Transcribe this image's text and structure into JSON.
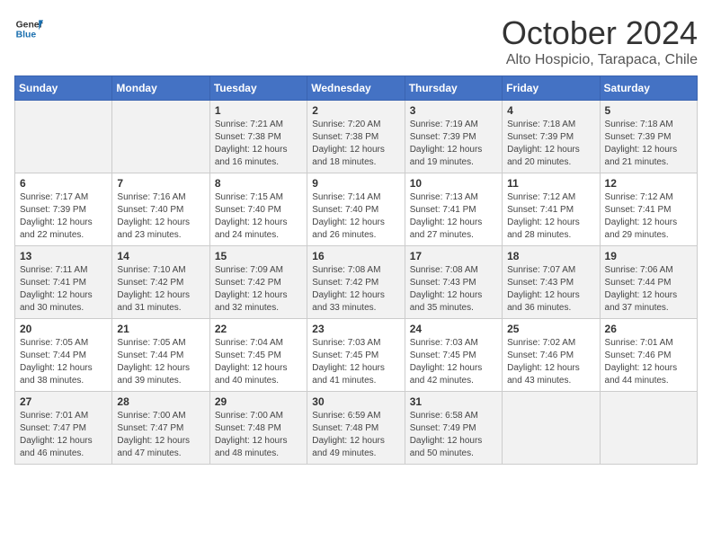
{
  "header": {
    "logo_general": "General",
    "logo_blue": "Blue",
    "month_title": "October 2024",
    "subtitle": "Alto Hospicio, Tarapaca, Chile"
  },
  "days_of_week": [
    "Sunday",
    "Monday",
    "Tuesday",
    "Wednesday",
    "Thursday",
    "Friday",
    "Saturday"
  ],
  "weeks": [
    [
      {
        "day": "",
        "info": ""
      },
      {
        "day": "",
        "info": ""
      },
      {
        "day": "1",
        "info": "Sunrise: 7:21 AM\nSunset: 7:38 PM\nDaylight: 12 hours and 16 minutes."
      },
      {
        "day": "2",
        "info": "Sunrise: 7:20 AM\nSunset: 7:38 PM\nDaylight: 12 hours and 18 minutes."
      },
      {
        "day": "3",
        "info": "Sunrise: 7:19 AM\nSunset: 7:39 PM\nDaylight: 12 hours and 19 minutes."
      },
      {
        "day": "4",
        "info": "Sunrise: 7:18 AM\nSunset: 7:39 PM\nDaylight: 12 hours and 20 minutes."
      },
      {
        "day": "5",
        "info": "Sunrise: 7:18 AM\nSunset: 7:39 PM\nDaylight: 12 hours and 21 minutes."
      }
    ],
    [
      {
        "day": "6",
        "info": "Sunrise: 7:17 AM\nSunset: 7:39 PM\nDaylight: 12 hours and 22 minutes."
      },
      {
        "day": "7",
        "info": "Sunrise: 7:16 AM\nSunset: 7:40 PM\nDaylight: 12 hours and 23 minutes."
      },
      {
        "day": "8",
        "info": "Sunrise: 7:15 AM\nSunset: 7:40 PM\nDaylight: 12 hours and 24 minutes."
      },
      {
        "day": "9",
        "info": "Sunrise: 7:14 AM\nSunset: 7:40 PM\nDaylight: 12 hours and 26 minutes."
      },
      {
        "day": "10",
        "info": "Sunrise: 7:13 AM\nSunset: 7:41 PM\nDaylight: 12 hours and 27 minutes."
      },
      {
        "day": "11",
        "info": "Sunrise: 7:12 AM\nSunset: 7:41 PM\nDaylight: 12 hours and 28 minutes."
      },
      {
        "day": "12",
        "info": "Sunrise: 7:12 AM\nSunset: 7:41 PM\nDaylight: 12 hours and 29 minutes."
      }
    ],
    [
      {
        "day": "13",
        "info": "Sunrise: 7:11 AM\nSunset: 7:41 PM\nDaylight: 12 hours and 30 minutes."
      },
      {
        "day": "14",
        "info": "Sunrise: 7:10 AM\nSunset: 7:42 PM\nDaylight: 12 hours and 31 minutes."
      },
      {
        "day": "15",
        "info": "Sunrise: 7:09 AM\nSunset: 7:42 PM\nDaylight: 12 hours and 32 minutes."
      },
      {
        "day": "16",
        "info": "Sunrise: 7:08 AM\nSunset: 7:42 PM\nDaylight: 12 hours and 33 minutes."
      },
      {
        "day": "17",
        "info": "Sunrise: 7:08 AM\nSunset: 7:43 PM\nDaylight: 12 hours and 35 minutes."
      },
      {
        "day": "18",
        "info": "Sunrise: 7:07 AM\nSunset: 7:43 PM\nDaylight: 12 hours and 36 minutes."
      },
      {
        "day": "19",
        "info": "Sunrise: 7:06 AM\nSunset: 7:44 PM\nDaylight: 12 hours and 37 minutes."
      }
    ],
    [
      {
        "day": "20",
        "info": "Sunrise: 7:05 AM\nSunset: 7:44 PM\nDaylight: 12 hours and 38 minutes."
      },
      {
        "day": "21",
        "info": "Sunrise: 7:05 AM\nSunset: 7:44 PM\nDaylight: 12 hours and 39 minutes."
      },
      {
        "day": "22",
        "info": "Sunrise: 7:04 AM\nSunset: 7:45 PM\nDaylight: 12 hours and 40 minutes."
      },
      {
        "day": "23",
        "info": "Sunrise: 7:03 AM\nSunset: 7:45 PM\nDaylight: 12 hours and 41 minutes."
      },
      {
        "day": "24",
        "info": "Sunrise: 7:03 AM\nSunset: 7:45 PM\nDaylight: 12 hours and 42 minutes."
      },
      {
        "day": "25",
        "info": "Sunrise: 7:02 AM\nSunset: 7:46 PM\nDaylight: 12 hours and 43 minutes."
      },
      {
        "day": "26",
        "info": "Sunrise: 7:01 AM\nSunset: 7:46 PM\nDaylight: 12 hours and 44 minutes."
      }
    ],
    [
      {
        "day": "27",
        "info": "Sunrise: 7:01 AM\nSunset: 7:47 PM\nDaylight: 12 hours and 46 minutes."
      },
      {
        "day": "28",
        "info": "Sunrise: 7:00 AM\nSunset: 7:47 PM\nDaylight: 12 hours and 47 minutes."
      },
      {
        "day": "29",
        "info": "Sunrise: 7:00 AM\nSunset: 7:48 PM\nDaylight: 12 hours and 48 minutes."
      },
      {
        "day": "30",
        "info": "Sunrise: 6:59 AM\nSunset: 7:48 PM\nDaylight: 12 hours and 49 minutes."
      },
      {
        "day": "31",
        "info": "Sunrise: 6:58 AM\nSunset: 7:49 PM\nDaylight: 12 hours and 50 minutes."
      },
      {
        "day": "",
        "info": ""
      },
      {
        "day": "",
        "info": ""
      }
    ]
  ]
}
